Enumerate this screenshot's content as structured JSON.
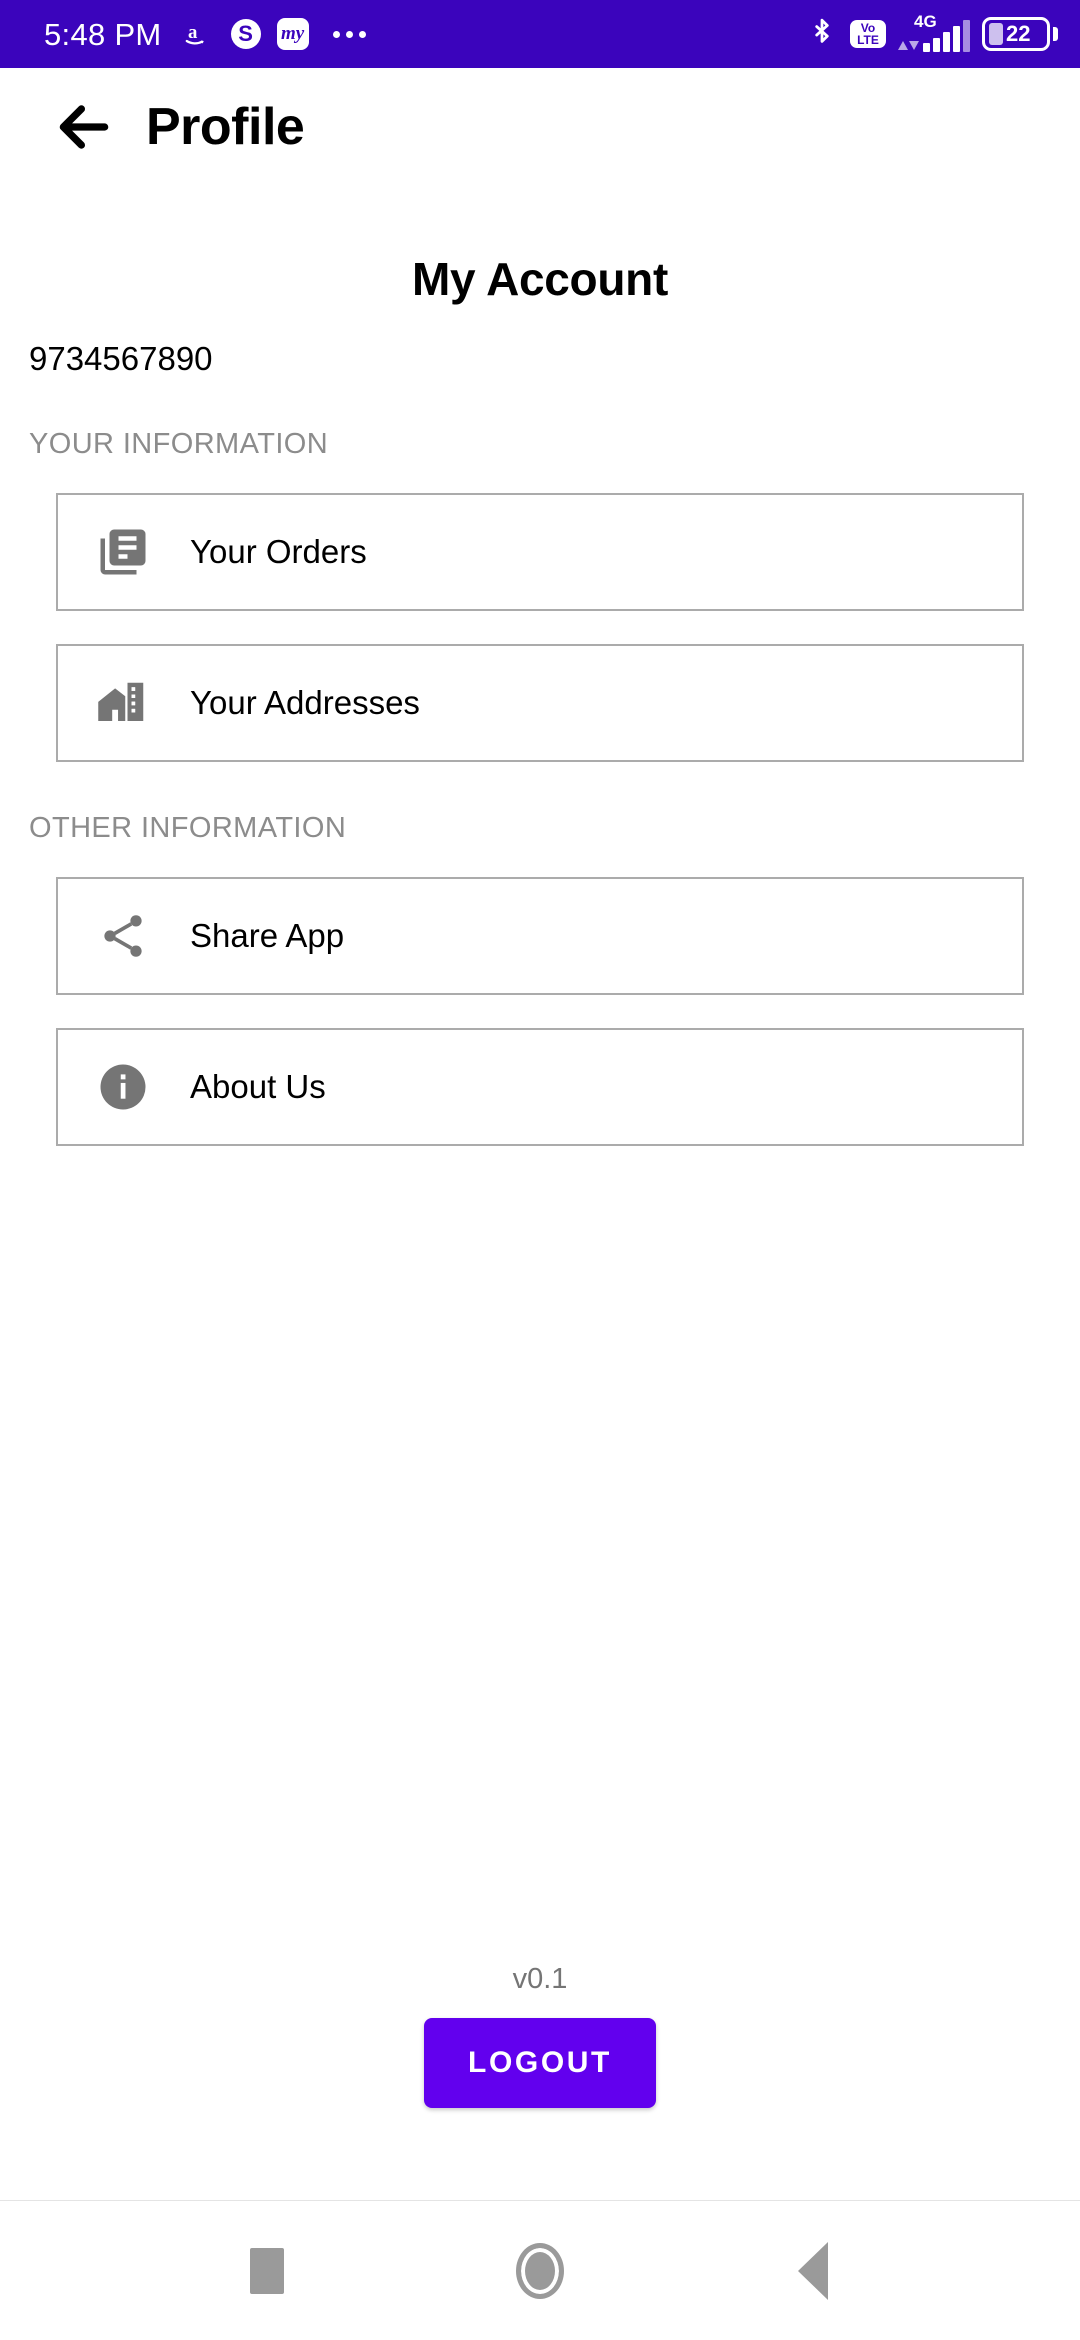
{
  "status_bar": {
    "time": "5:48 PM",
    "background_color": "#3B04BC",
    "notification_icons": [
      {
        "name": "amazon-icon",
        "glyph": "a"
      },
      {
        "name": "skype-icon",
        "glyph": "S"
      },
      {
        "name": "myntra-icon",
        "glyph": "my"
      }
    ],
    "overflow_indicator": "•••",
    "bluetooth_icon": "bluetooth-icon",
    "volte_line1": "Vo",
    "volte_line2": "LTE",
    "network_type": "4G",
    "signal_bars": 5,
    "battery_level": "22"
  },
  "app_bar": {
    "back_icon": "back-arrow-icon",
    "title": "Profile"
  },
  "main": {
    "page_title": "My Account",
    "phone_number": "9734567890",
    "sections": [
      {
        "label": "YOUR INFORMATION",
        "items": [
          {
            "icon": "library-books-icon",
            "label": "Your Orders"
          },
          {
            "icon": "home-work-icon",
            "label": "Your Addresses"
          }
        ]
      },
      {
        "label": "OTHER INFORMATION",
        "items": [
          {
            "icon": "share-icon",
            "label": "Share App"
          },
          {
            "icon": "info-icon",
            "label": "About Us"
          }
        ]
      }
    ],
    "version": "v0.1",
    "logout_label": "LOGOUT",
    "logout_color": "#6200EE",
    "section_label_color": "#8C8C8C",
    "card_border_color": "#ABABAB",
    "icon_color": "#757575"
  },
  "nav_bar": {
    "recents_label": "recents-square-icon",
    "home_label": "home-circle-icon",
    "back_label": "back-triangle-icon"
  }
}
